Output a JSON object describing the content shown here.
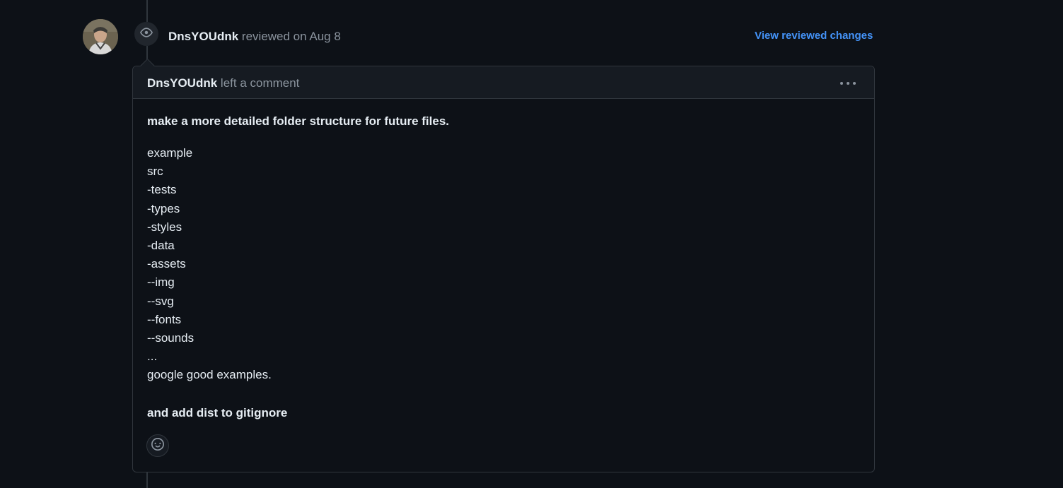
{
  "review": {
    "author": "DnsYOUdnk",
    "action_text": "reviewed on Aug 8",
    "view_changes_label": "View reviewed changes"
  },
  "comment": {
    "author": "DnsYOUdnk",
    "action_text": "left a comment",
    "heading": "make a more detailed folder structure for future files.",
    "lines": [
      "example",
      "src",
      "-tests",
      "-types",
      "-styles",
      "-data",
      "-assets",
      "--img",
      "--svg",
      "--fonts",
      "--sounds",
      "...",
      "google good examples."
    ],
    "footer": "and add dist to gitignore"
  },
  "icons": {
    "review": "eye-icon",
    "menu": "kebab-horizontal-icon",
    "reaction": "smiley-icon"
  },
  "colors": {
    "background": "#0d1117",
    "header_bg": "#161b22",
    "border": "#30363d",
    "link": "#4493f8",
    "muted": "#8b949e"
  }
}
